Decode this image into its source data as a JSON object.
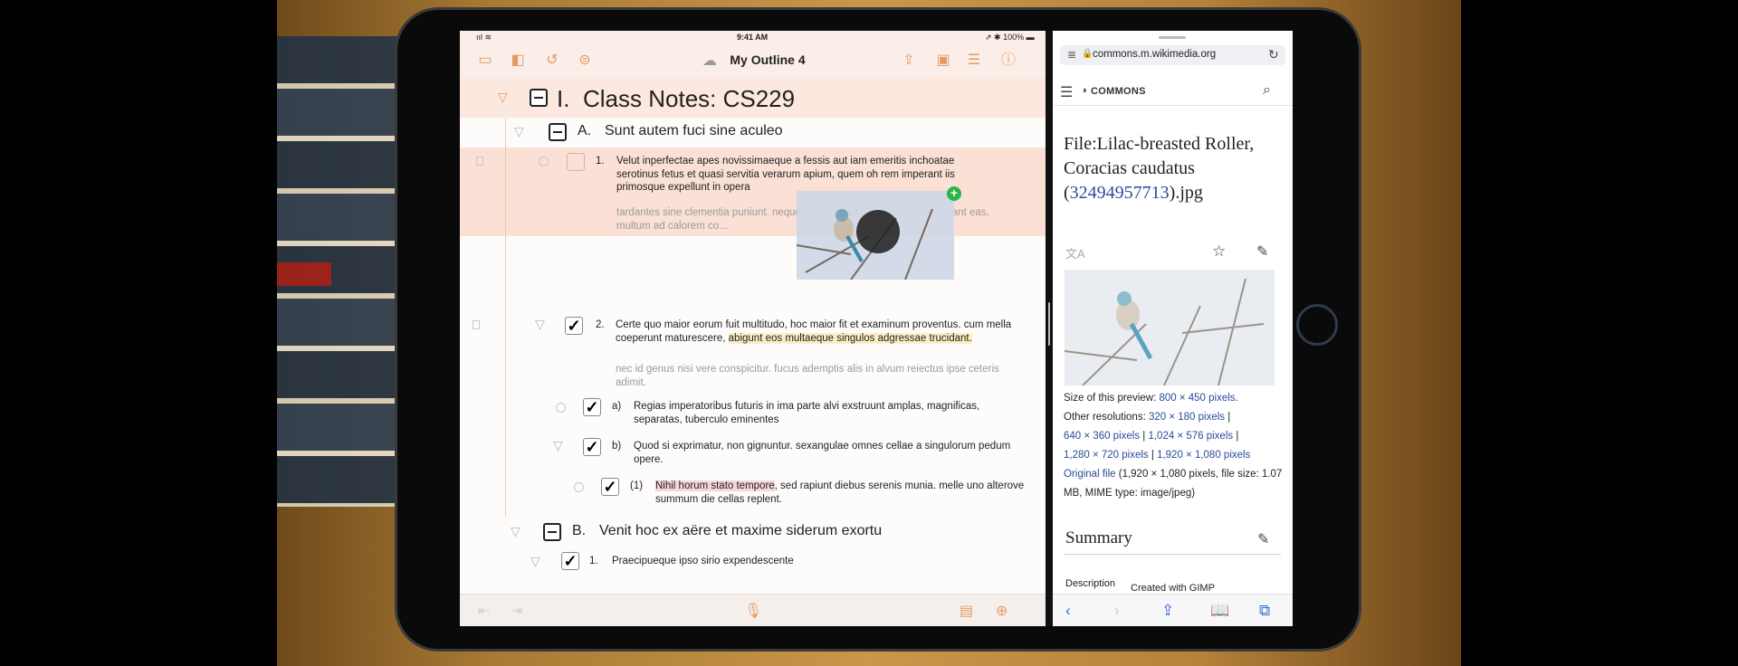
{
  "status_bar": {
    "signal": "ııl ≋",
    "time": "9:41 AM",
    "battery": "⇗ ✱ 100% ▬"
  },
  "outliner": {
    "title": "My Outline 4",
    "rows": {
      "heading_1": {
        "label": "I.",
        "text": "Class Notes: CS229"
      },
      "heading_a": {
        "label": "A.",
        "text": "Sunt autem fuci sine aculeo"
      },
      "item_1": {
        "label": "1.",
        "text": "Velut inperfectae apes novissimaeque a fessis aut iam emeritis inchoatae serotinus fetus et quasi servitia verarum apium, quem oh rem imperant iis primosque expellunt in opera",
        "note": "tardantes sine clementia puniunt. neque in ... ..., sed tutum quoque adiuvant eas, multum ad calorem co..."
      },
      "item_2": {
        "label": "2.",
        "text_plain": "Certe quo maior eorum fuit multitudo, hoc maior fit et examinum proventus. cum mella coeperunt maturescere,",
        "text_highlight": "abigunt eos multaeque singulos adgressae trucidant.",
        "note": "nec id genus nisi vere conspicitur. fucus ademptis alis in alvum reiectus ipse ceteris adimit."
      },
      "item_a": {
        "label": "a)",
        "text": "Regias imperatoribus futuris in ima parte alvi exstruunt amplas, magnificas, separatas, tuberculo eminentes"
      },
      "item_b": {
        "label": "b)",
        "text": "Quod si exprimatur, non gignuntur. sexangulae omnes cellae a singulorum pedum opere."
      },
      "item_b1": {
        "label": "(1)",
        "text_highlight": "Nihil horum stato tempore",
        "text_plain": ", sed rapiunt diebus serenis munia. melle uno alterove summum die cellas replent."
      },
      "heading_b": {
        "label": "B.",
        "text": "Venit hoc ex aëre et maxime siderum exortu"
      },
      "item_b_1": {
        "label": "1.",
        "text": "Praecipueque ipso sirio expendescente"
      }
    }
  },
  "safari": {
    "url": "commons.m.wikimedia.org",
    "site_name": "COMMONS",
    "file_title_prefix": "File:Lilac-breasted Roller, Coracias caudatus (",
    "file_title_link": "32494957713",
    "file_title_suffix": ").jpg",
    "preview_label": "Size of this preview:",
    "preview_size": "800 × 450 pixels",
    "other_label": "Other resolutions:",
    "res_1": "320 × 180 pixels",
    "res_2": "640 × 360 pixels",
    "res_3": "1,024 × 576 pixels",
    "res_4": "1,280 × 720 pixels",
    "res_5": "1,920 × 1,080 pixels",
    "original_link": "Original file",
    "original_info": "(1,920 × 1,080 pixels, file size: 1.07 MB, MIME type: image/jpeg)",
    "summary_heading": "Summary",
    "description_label": "Description",
    "description_value": "Created with GIMP"
  },
  "colors": {
    "accent_orange": "#e39b66",
    "link_blue": "#2a4b9c",
    "ios_blue": "#2f6fd7",
    "drop_green": "#2cb34a"
  }
}
